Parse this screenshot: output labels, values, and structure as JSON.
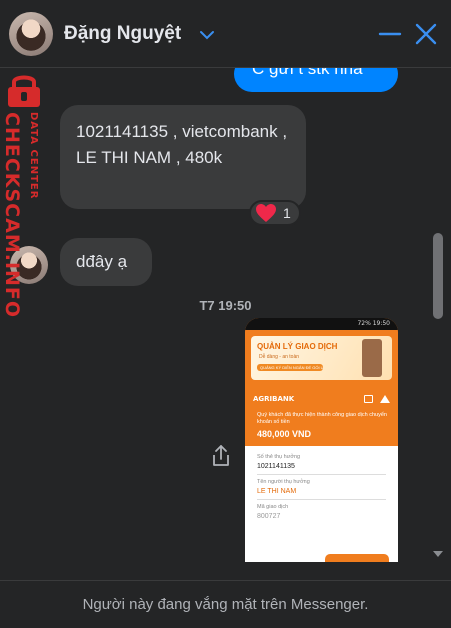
{
  "header": {
    "contact_name": "Đặng Nguyệt",
    "icons": [
      "chevron-down-icon",
      "minimize-icon",
      "close-icon"
    ],
    "accent_color": "#0084ff"
  },
  "watermark": {
    "brand": "CHECKSCAM.INFO",
    "tagline": "DATA CENTER",
    "color": "#d62b2b"
  },
  "messages": {
    "outgoing_partial": "C gửi t stk nha",
    "incoming_bank": "1021141135 , vietcombank , LE THI NAM , 480k",
    "reaction_emoji": "heart",
    "reaction_count": "1",
    "incoming_day": "dđây ạ",
    "timestamp": "T7 19:50"
  },
  "image_attachment": {
    "status_bar": "72% 19:50",
    "banner_title": "QUẢN LÝ GIAO DỊCH",
    "banner_sub": "Dễ dàng - an toàn",
    "banner_pill": "QUẢNG KÝ DIỄN NGÂN ĐỂ GÓI ƯU ĐÃI",
    "bank_logo": "AGRIBANK",
    "success_message": "Quý khách đã thực hiện thành công giao dịch chuyển khoản số tiền",
    "amount": "480,000 VND",
    "fields": [
      {
        "label": "Số thẻ thụ hưởng",
        "value": "1021141135"
      },
      {
        "label": "Tên người thụ hưởng",
        "value": "LE THI NAM"
      },
      {
        "label": "Mã giao dịch",
        "value": "800727"
      }
    ]
  },
  "footer": {
    "status_text": "Người này đang vắng mặt trên Messenger."
  }
}
